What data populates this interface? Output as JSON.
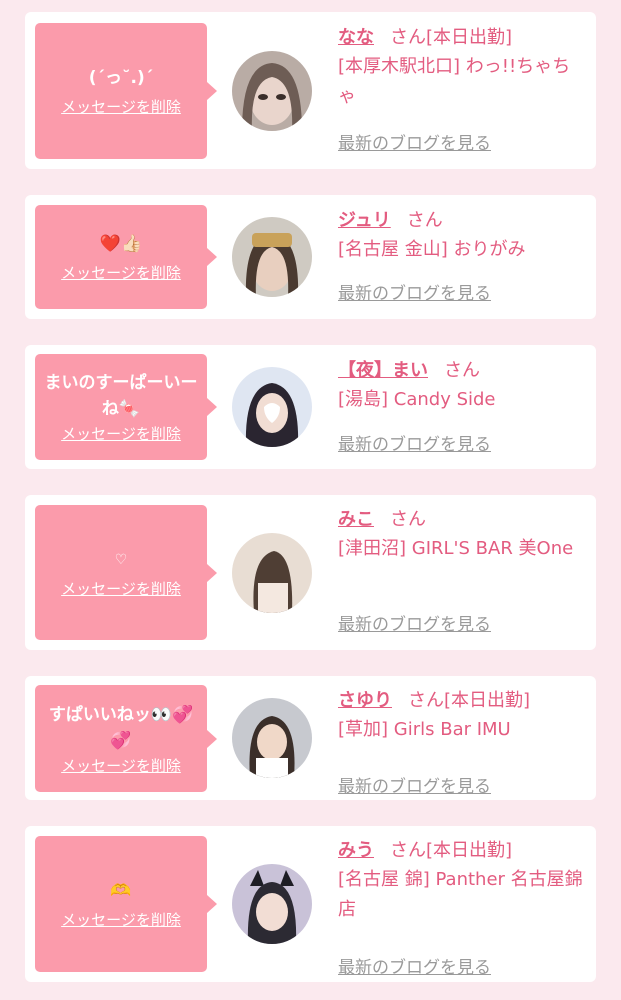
{
  "cards": [
    {
      "message": "(ˊっ˘.)ˊ",
      "delete_label": "メッセージを削除",
      "name": "なな",
      "san": "さん",
      "status": "[本日出勤]",
      "shop": "[本厚木駅北口] わっ!!ちゃちゃ",
      "blog_label": "最新のブログを見る"
    },
    {
      "message": "❤️👍🏻",
      "delete_label": "メッセージを削除",
      "name": "ジュリ",
      "san": "さん",
      "status": "",
      "shop": "[名古屋 金山] おりがみ",
      "blog_label": "最新のブログを見る"
    },
    {
      "message": "まいのすーぱーいーね🍬",
      "delete_label": "メッセージを削除",
      "name": "【夜】まい",
      "san": "さん",
      "status": "",
      "shop": "[湯島] Candy Side",
      "blog_label": "最新のブログを見る"
    },
    {
      "message": "♡",
      "delete_label": "メッセージを削除",
      "name": "みこ",
      "san": "さん",
      "status": "",
      "shop": "[津田沼] GIRL'S BAR 美One",
      "blog_label": "最新のブログを見る"
    },
    {
      "message": "すぱいいねッ👀💞💞",
      "delete_label": "メッセージを削除",
      "name": "さゆり",
      "san": "さん",
      "status": "[本日出勤]",
      "shop": "[草加] Girls Bar IMU",
      "blog_label": "最新のブログを見る"
    },
    {
      "message": "🫶",
      "delete_label": "メッセージを削除",
      "name": "みう",
      "san": "さん",
      "status": "[本日出勤]",
      "shop": "[名古屋 錦] Panther 名古屋錦店",
      "blog_label": "最新のブログを見る"
    }
  ],
  "colors": {
    "page_bg": "#fbe9ee",
    "bubble": "#fb9bab",
    "accent": "#e35c80",
    "link_gray": "#9a9a9a"
  }
}
